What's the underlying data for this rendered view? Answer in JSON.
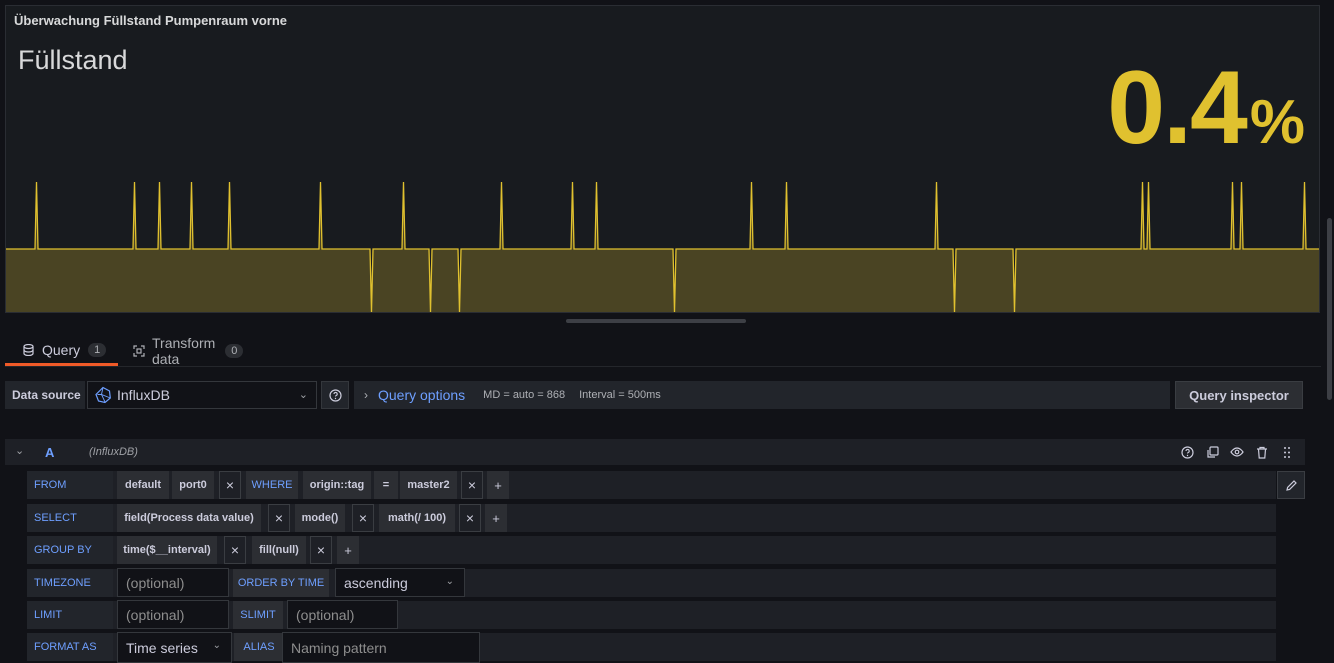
{
  "panel": {
    "title": "Überwachung Füllstand Pumpenraum vorne",
    "stat_label": "Füllstand",
    "stat_value": "0.4",
    "stat_unit": "%",
    "color": "#e0c12f"
  },
  "tabs": [
    {
      "label": "Query",
      "count": "1",
      "icon": "database-icon"
    },
    {
      "label": "Transform data",
      "count": "0",
      "icon": "transform-icon"
    }
  ],
  "datasource": {
    "label": "Data source",
    "name": "InfluxDB",
    "query_options_label": "Query options",
    "md": "MD = auto = 868",
    "interval": "Interval = 500ms",
    "inspector_label": "Query inspector"
  },
  "query": {
    "ref": "A",
    "ds": "(InfluxDB)",
    "from": {
      "keyword": "FROM",
      "policy": "default",
      "measurement": "port0",
      "where": "WHERE",
      "tag": "origin::tag",
      "op": "=",
      "value": "master2"
    },
    "select": {
      "keyword": "SELECT",
      "field": "field(Process data value)",
      "agg": "mode()",
      "math": "math(/ 100)"
    },
    "group_by": {
      "keyword": "GROUP BY",
      "time": "time($__interval)",
      "fill": "fill(null)"
    },
    "timezone": {
      "keyword": "TIMEZONE",
      "placeholder": "(optional)",
      "order_label": "ORDER BY TIME",
      "order_value": "ascending"
    },
    "limit": {
      "keyword": "LIMIT",
      "placeholder": "(optional)",
      "slimit_label": "SLIMIT",
      "slimit_placeholder": "(optional)"
    },
    "format": {
      "keyword": "FORMAT AS",
      "value": "Time series",
      "alias_label": "ALIAS",
      "alias_placeholder": "Naming pattern"
    },
    "remove_symbol": "×",
    "add_symbol": "+"
  }
}
